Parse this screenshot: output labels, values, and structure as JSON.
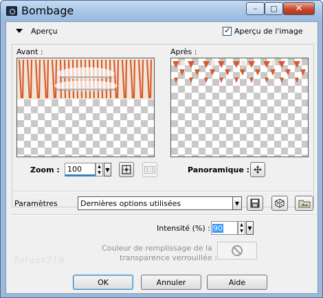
{
  "window": {
    "title": "Bombage",
    "min_glyph": "–",
    "max_glyph": "□",
    "close_glyph": "✕"
  },
  "preview": {
    "section_label": "Aperçu",
    "show_preview_label": "Aperçu de l'image",
    "before_label": "Avant :",
    "after_label": "Après :",
    "zoom_label": "Zoom :",
    "zoom_value": "100",
    "one_to_one_label": "1:1",
    "pan_label": "Panoramique :"
  },
  "settings": {
    "label": "Paramètres",
    "preset_value": "Dernières options utilisées"
  },
  "options": {
    "intensity_label": "Intensité (%) :",
    "intensity_value": "90",
    "fill_color_label_line1": "Couleur de remplissage de la",
    "fill_color_label_line2": "transparence verrouillée :"
  },
  "watermark": "Taluar318",
  "buttons": {
    "ok": "OK",
    "cancel": "Annuler",
    "help": "Aide"
  },
  "colors": {
    "accent": "#3c7fb1",
    "pattern_orange": "#d95a2b",
    "pattern_cream": "#f1e6da"
  }
}
